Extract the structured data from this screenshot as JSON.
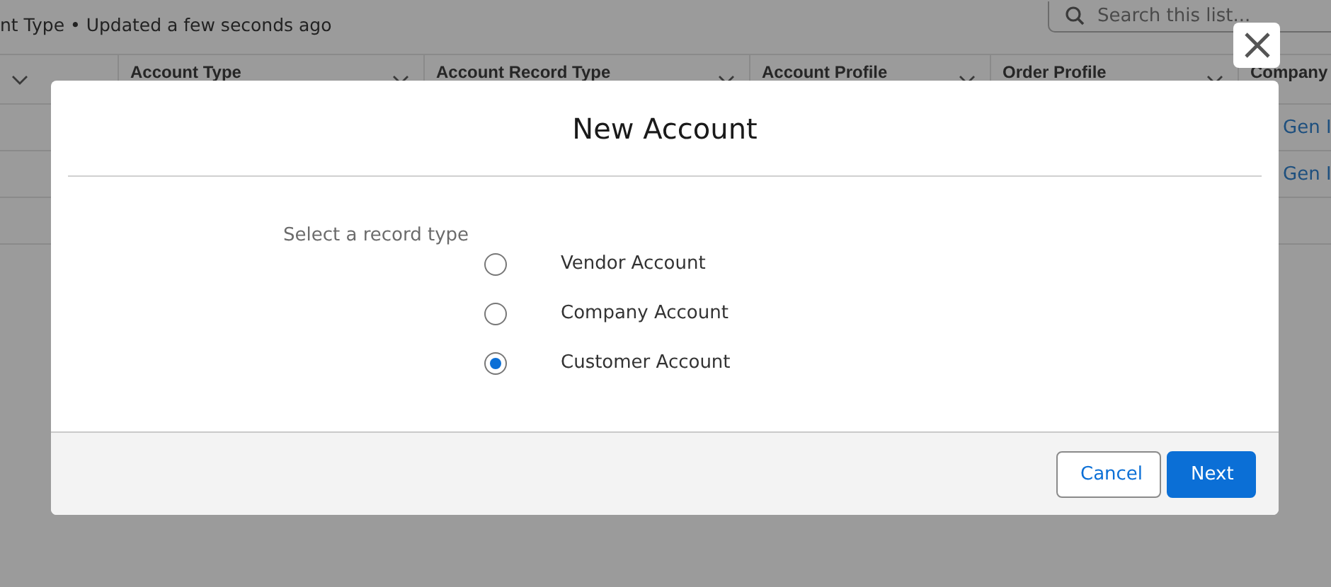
{
  "list_header": {
    "subtitle": "nt Type • Updated a few seconds ago",
    "search": {
      "placeholder": "Search this list..."
    }
  },
  "table": {
    "columns": [
      {},
      {
        "label": "Account Type"
      },
      {
        "label": "Account Record Type"
      },
      {
        "label": "Account Profile"
      },
      {
        "label": "Order Profile"
      },
      {
        "label": "Company"
      }
    ],
    "rows": [
      {
        "company": "Gen I"
      },
      {
        "company": "Gen I"
      },
      {}
    ]
  },
  "modal": {
    "title": "New Account",
    "prompt": "Select a record type",
    "options": [
      {
        "label": "Vendor Account",
        "selected": false
      },
      {
        "label": "Company Account",
        "selected": false
      },
      {
        "label": "Customer Account",
        "selected": true
      }
    ],
    "buttons": [
      {
        "label": "Cancel",
        "kind": "neutral"
      },
      {
        "label": "Next",
        "kind": "brand"
      }
    ]
  }
}
